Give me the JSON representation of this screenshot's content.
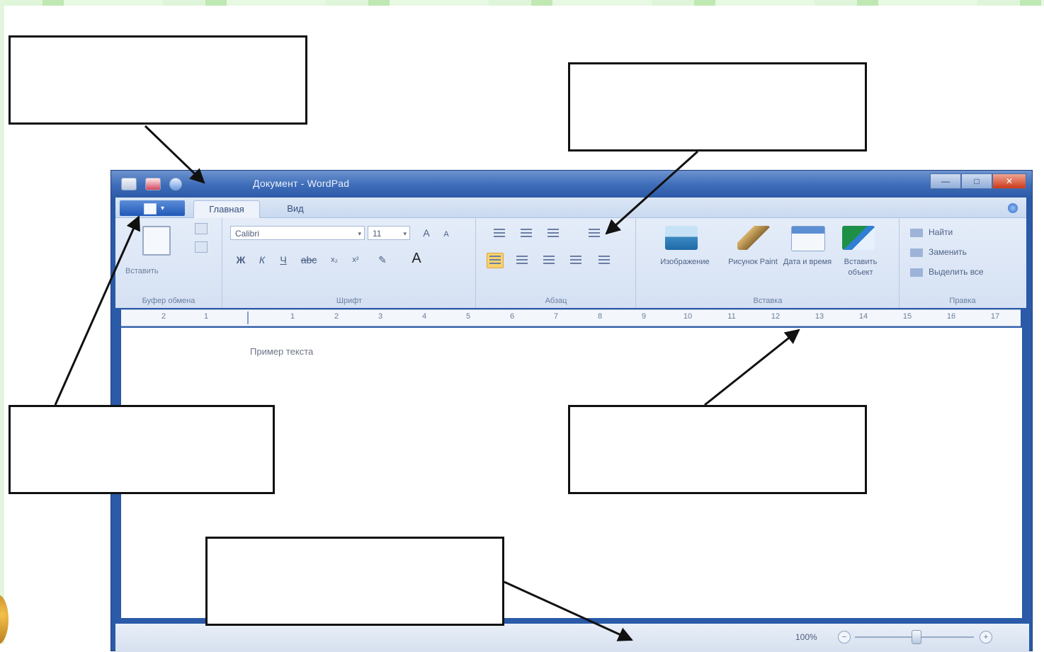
{
  "window": {
    "title": "Документ - WordPad",
    "controls": [
      "—",
      "□",
      "✕"
    ]
  },
  "ribbon": {
    "tabs": [
      "Главная",
      "Вид"
    ],
    "clipboard": {
      "paste_label": "Вставить",
      "group_label": "Буфер обмена"
    },
    "font": {
      "family": "Calibri",
      "size": "11",
      "group_label": "Шрифт"
    },
    "paragraph": {
      "group_label": "Абзац"
    },
    "insert": {
      "group_label": "Вставка",
      "items": [
        "Изображение",
        "Рисунок Paint",
        "Дата и время",
        "Вставить объект"
      ]
    },
    "edit": {
      "group_label": "Правка",
      "items": [
        "Найти",
        "Заменить",
        "Выделить все"
      ]
    }
  },
  "ruler": {
    "ticks": [
      "2",
      "1",
      "1",
      "2",
      "3",
      "4",
      "5",
      "6",
      "7",
      "8",
      "9",
      "10",
      "11",
      "12",
      "13",
      "14",
      "15",
      "16",
      "17"
    ]
  },
  "document": {
    "text": "Пример текста"
  },
  "status": {
    "zoom": "100%"
  }
}
